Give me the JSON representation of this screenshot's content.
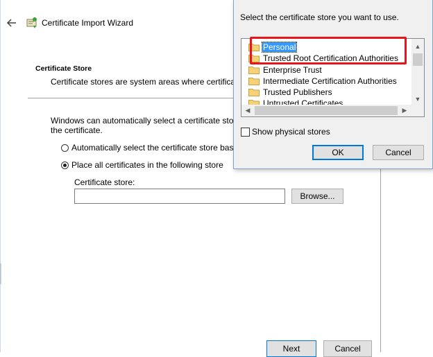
{
  "wizard": {
    "title": "Certificate Import Wizard",
    "section_heading": "Certificate Store",
    "section_desc": "Certificate stores are system areas where certificates",
    "auto_text_1": "Windows can automatically select a certificate store, o",
    "auto_text_2": "the certificate.",
    "radio_auto_label": "Automatically select the certificate store based",
    "radio_place_label": "Place all certificates in the following store",
    "store_label": "Certificate store:",
    "store_value": "",
    "browse_label": "Browse...",
    "next_label": "Next",
    "cancel_label": "Cancel"
  },
  "dialog": {
    "prompt": "Select the certificate store you want to use.",
    "stores": [
      {
        "label": "Personal",
        "selected": true
      },
      {
        "label": "Trusted Root Certification Authorities",
        "selected": false
      },
      {
        "label": "Enterprise Trust",
        "selected": false
      },
      {
        "label": "Intermediate Certification Authorities",
        "selected": false
      },
      {
        "label": "Trusted Publishers",
        "selected": false
      },
      {
        "label": "Untrusted Certificates",
        "selected": false
      }
    ],
    "show_physical_label": "Show physical stores",
    "show_physical_checked": false,
    "ok_label": "OK",
    "cancel_label": "Cancel"
  },
  "icons": {
    "back": "back-arrow-icon",
    "wizard": "certificate-icon",
    "folder": "folder-icon"
  },
  "colors": {
    "selection": "#3399ff",
    "highlight": "#e8141b",
    "folder": "#f5d27a",
    "default_button_border": "#0078d7"
  }
}
